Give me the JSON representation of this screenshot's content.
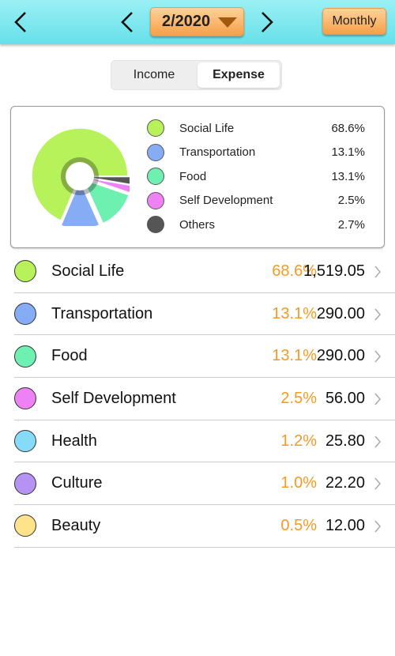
{
  "header": {
    "month_label": "2/2020",
    "period_label": "Monthly"
  },
  "toggle": {
    "income_label": "Income",
    "expense_label": "Expense",
    "selected": "Expense"
  },
  "chart_data": {
    "type": "pie",
    "title": "",
    "slices": [
      {
        "name": "Social Life",
        "value": 68.6,
        "label": "68.6%",
        "color": "#b7f25a"
      },
      {
        "name": "Transportation",
        "value": 13.1,
        "label": "13.1%",
        "color": "#86acf5"
      },
      {
        "name": "Food",
        "value": 13.1,
        "label": "13.1%",
        "color": "#6ef0b0"
      },
      {
        "name": "Self Development",
        "value": 2.5,
        "label": "2.5%",
        "color": "#ee82f5"
      },
      {
        "name": "Others",
        "value": 2.7,
        "label": "2.7%",
        "color": "#555555"
      }
    ],
    "legend_position": "right"
  },
  "categories": [
    {
      "name": "Social Life",
      "percent": "68.6%",
      "amount": "1,519.05",
      "color": "#b7f25a"
    },
    {
      "name": "Transportation",
      "percent": "13.1%",
      "amount": "290.00",
      "color": "#86acf5"
    },
    {
      "name": "Food",
      "percent": "13.1%",
      "amount": "290.00",
      "color": "#6ef0b0"
    },
    {
      "name": "Self Development",
      "percent": "2.5%",
      "amount": "56.00",
      "color": "#ee82f5"
    },
    {
      "name": "Health",
      "percent": "1.2%",
      "amount": "25.80",
      "color": "#86dcf8"
    },
    {
      "name": "Culture",
      "percent": "1.0%",
      "amount": "22.20",
      "color": "#b692f2"
    },
    {
      "name": "Beauty",
      "percent": "0.5%",
      "amount": "12.00",
      "color": "#ffe38a"
    }
  ],
  "colors": {
    "header": "#7fe8ee",
    "accent_button": "#f5a048",
    "percent_text": "#f39a25"
  },
  "icons": {
    "back": "chevron-left-icon",
    "prev": "chevron-left-icon",
    "next": "chevron-right-icon",
    "dropdown": "triangle-down-icon",
    "row_arrow": "chevron-right-icon"
  }
}
